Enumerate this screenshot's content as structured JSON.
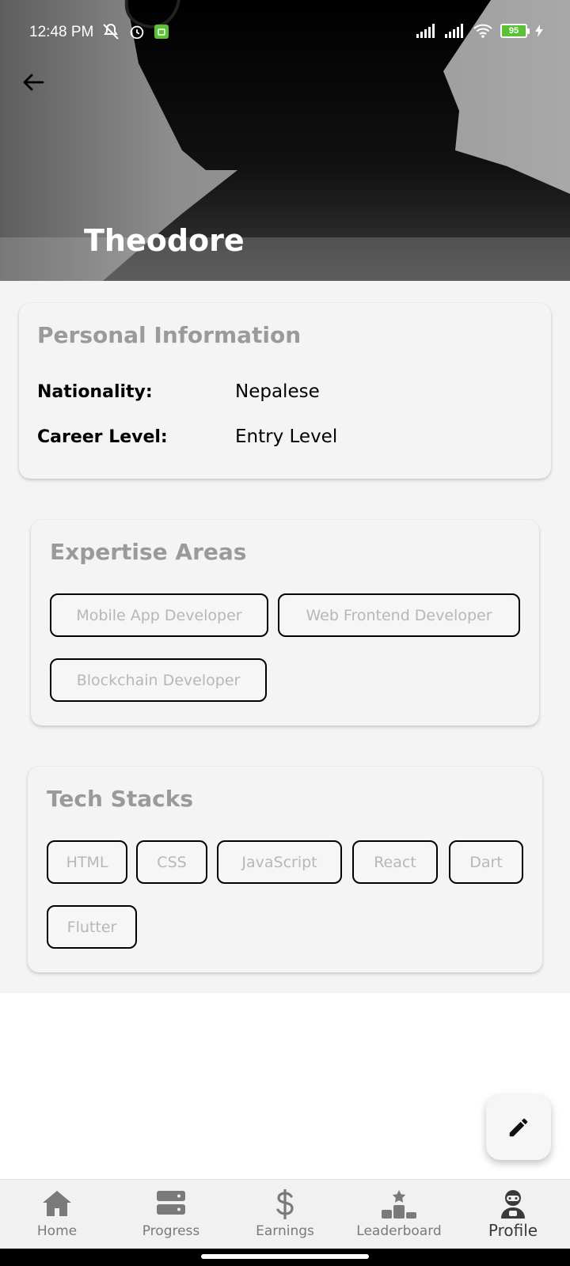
{
  "status_bar": {
    "time": "12:48 PM",
    "battery": "95",
    "left_icons": [
      "mute-icon",
      "alarm-icon",
      "android-icon"
    ],
    "right_icons": [
      "signal-icon",
      "signal-icon",
      "wifi-icon",
      "battery-icon",
      "charging-icon"
    ]
  },
  "header": {
    "name": "Theodore",
    "back_icon": "arrow-left-icon"
  },
  "personal": {
    "title": "Personal Information",
    "rows": [
      {
        "label": "Nationality:",
        "value": "Nepalese"
      },
      {
        "label": "Career Level:",
        "value": "Entry Level"
      }
    ]
  },
  "expertise": {
    "title": "Expertise Areas",
    "chips": [
      "Mobile App Developer",
      "Web Frontend Developer",
      "Blockchain Developer"
    ]
  },
  "tech": {
    "title": "Tech Stacks",
    "chips": [
      "HTML",
      "CSS",
      "JavaScript",
      "React",
      "Dart",
      "Flutter"
    ]
  },
  "fab": {
    "icon": "pencil-icon"
  },
  "nav": {
    "items": [
      {
        "label": "Home",
        "icon": "home-icon",
        "active": false
      },
      {
        "label": "Progress",
        "icon": "progress-icon",
        "active": false
      },
      {
        "label": "Earnings",
        "icon": "dollar-icon",
        "active": false
      },
      {
        "label": "Leaderboard",
        "icon": "podium-icon",
        "active": false
      },
      {
        "label": "Profile",
        "icon": "profile-icon",
        "active": true
      }
    ]
  },
  "colors": {
    "card_title": "#9a9a9a",
    "chip_text": "#b7b7b7",
    "chip_border": "#000000",
    "battery": "#5bc236"
  }
}
